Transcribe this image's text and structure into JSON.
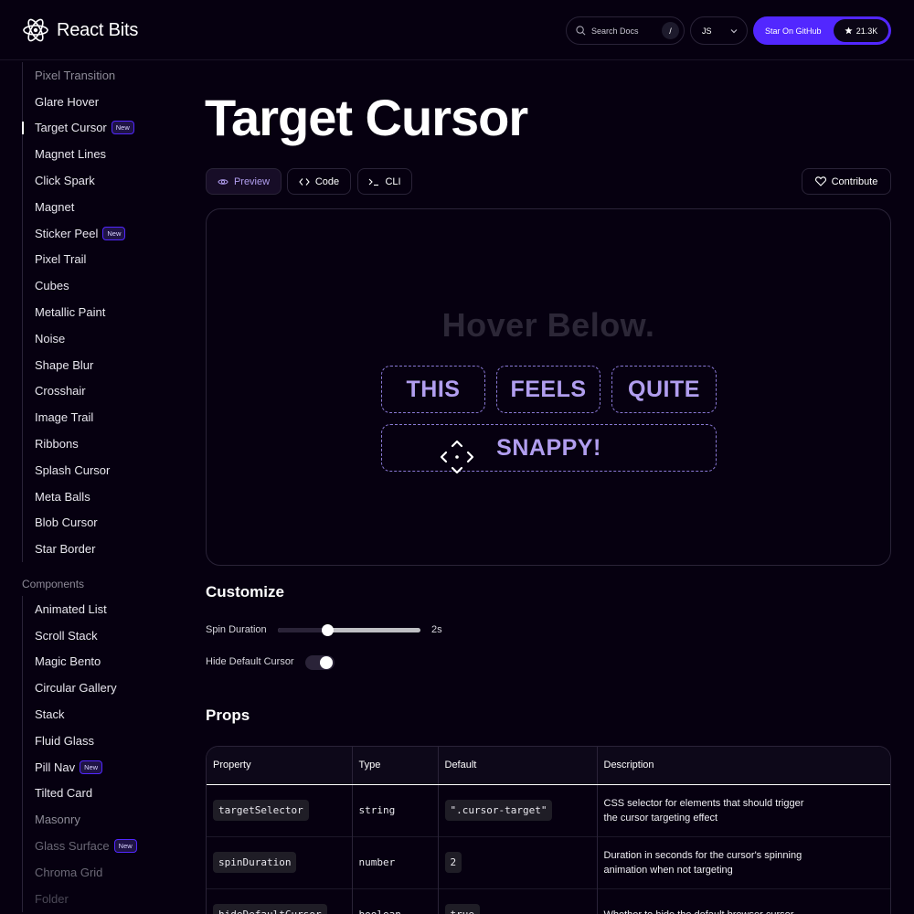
{
  "header": {
    "logo_text": "React Bits",
    "search_placeholder": "Search Docs",
    "search_shortcut": "/",
    "language": "JS",
    "github_label": "Star On GitHub",
    "github_stars": "21.3K"
  },
  "sidebar": {
    "group1": [
      {
        "label": "Pixel Transition",
        "badge": ""
      },
      {
        "label": "Glare Hover",
        "badge": ""
      },
      {
        "label": "Target Cursor",
        "badge": "New"
      },
      {
        "label": "Magnet Lines",
        "badge": ""
      },
      {
        "label": "Click Spark",
        "badge": ""
      },
      {
        "label": "Magnet",
        "badge": ""
      },
      {
        "label": "Sticker Peel",
        "badge": "New"
      },
      {
        "label": "Pixel Trail",
        "badge": ""
      },
      {
        "label": "Cubes",
        "badge": ""
      },
      {
        "label": "Metallic Paint",
        "badge": ""
      },
      {
        "label": "Noise",
        "badge": ""
      },
      {
        "label": "Shape Blur",
        "badge": ""
      },
      {
        "label": "Crosshair",
        "badge": ""
      },
      {
        "label": "Image Trail",
        "badge": ""
      },
      {
        "label": "Ribbons",
        "badge": ""
      },
      {
        "label": "Splash Cursor",
        "badge": ""
      },
      {
        "label": "Meta Balls",
        "badge": ""
      },
      {
        "label": "Blob Cursor",
        "badge": ""
      },
      {
        "label": "Star Border",
        "badge": ""
      }
    ],
    "section_title": "Components",
    "group2": [
      {
        "label": "Animated List",
        "badge": ""
      },
      {
        "label": "Scroll Stack",
        "badge": ""
      },
      {
        "label": "Magic Bento",
        "badge": ""
      },
      {
        "label": "Circular Gallery",
        "badge": ""
      },
      {
        "label": "Stack",
        "badge": ""
      },
      {
        "label": "Fluid Glass",
        "badge": ""
      },
      {
        "label": "Pill Nav",
        "badge": "New"
      },
      {
        "label": "Tilted Card",
        "badge": ""
      },
      {
        "label": "Masonry",
        "badge": ""
      },
      {
        "label": "Glass Surface",
        "badge": "New"
      },
      {
        "label": "Chroma Grid",
        "badge": ""
      },
      {
        "label": "Folder",
        "badge": ""
      }
    ]
  },
  "main": {
    "title": "Target Cursor",
    "tabs": {
      "preview": "Preview",
      "code": "Code",
      "cli": "CLI"
    },
    "contribute": "Contribute",
    "demo": {
      "hover_text": "Hover Below.",
      "targets": [
        "THIS",
        "FEELS",
        "QUITE",
        "SNAPPY!"
      ]
    },
    "customize": {
      "title": "Customize",
      "spin_label": "Spin Duration",
      "spin_value_text": "2s",
      "spin_fraction": 0.35,
      "hide_label": "Hide Default Cursor",
      "hide_enabled": true
    },
    "props": {
      "title": "Props",
      "columns": [
        "Property",
        "Type",
        "Default",
        "Description"
      ],
      "rows": [
        {
          "property": "targetSelector",
          "type": "string",
          "default": "\".cursor-target\"",
          "desc1": "CSS selector for elements that should trigger",
          "desc2": "the cursor targeting effect"
        },
        {
          "property": "spinDuration",
          "type": "number",
          "default": "2",
          "desc1": "Duration in seconds for the cursor's spinning",
          "desc2": "animation when not targeting"
        },
        {
          "property": "hideDefaultCursor",
          "type": "boolean",
          "default": "true",
          "desc1": "Whether to hide the default browser cursor",
          "desc2": ""
        }
      ]
    }
  }
}
